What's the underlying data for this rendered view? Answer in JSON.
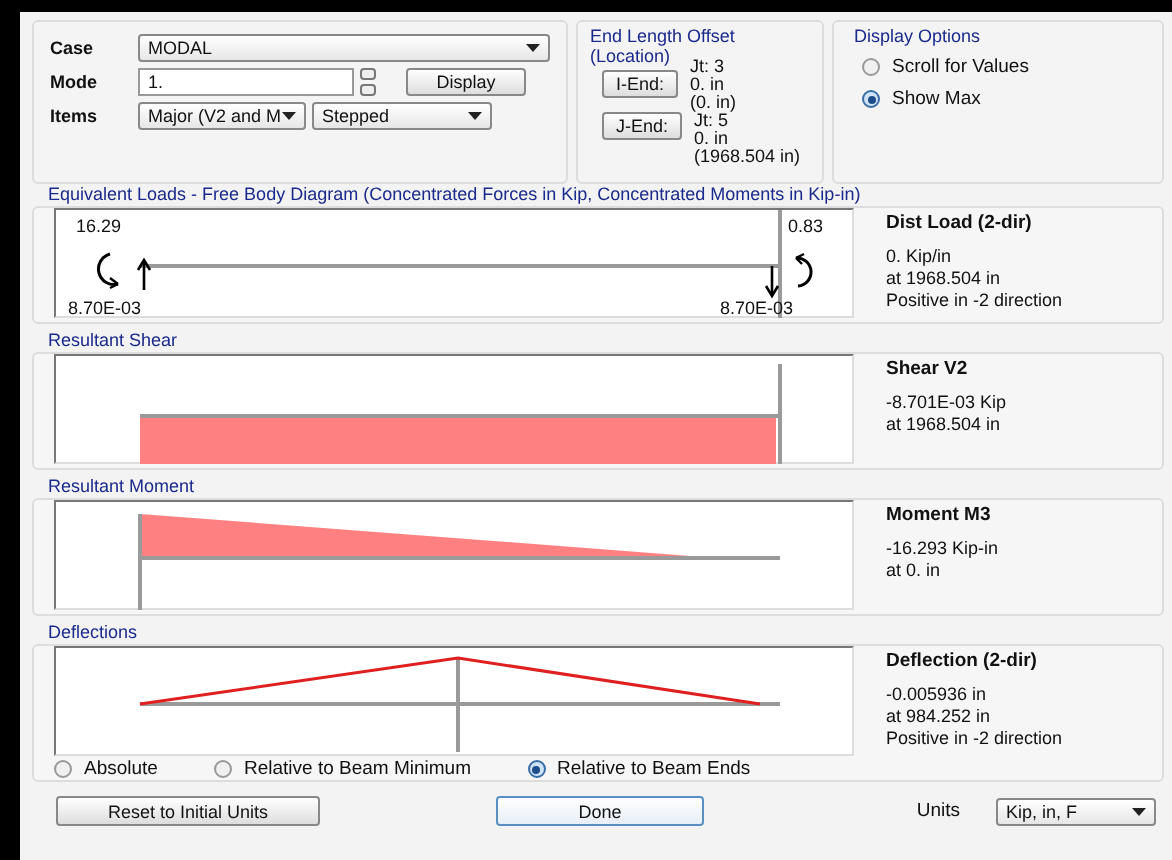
{
  "analysis": {
    "case": {
      "label": "Case",
      "value": "MODAL"
    },
    "mode": {
      "label": "Mode",
      "value": "1.",
      "button": "Display"
    },
    "items": {
      "label": "Items",
      "values": [
        "Major (V2 and M",
        "Stepped"
      ]
    }
  },
  "end_length_offset": {
    "title": "End Length Offset",
    "subtitle": "(Location)",
    "ends": [
      {
        "button": "I-End:",
        "joint": "Jt: 3",
        "offset": "0. in",
        "location": "(0. in)"
      },
      {
        "button": "J-End:",
        "joint": "Jt: 5",
        "offset": "0. in",
        "location": "(1968.504 in)"
      }
    ]
  },
  "display_options": {
    "title": "Display Options",
    "options": [
      {
        "label": "Scroll for Values",
        "selected": false
      },
      {
        "label": "Show Max",
        "selected": true
      }
    ]
  },
  "sections": [
    {
      "kind": "loads",
      "title": "Equivalent Loads - Free Body Diagram  (Concentrated Forces in Kip, Concentrated Moments in Kip-in)",
      "labels": [
        "16.29",
        "0.83",
        "8.70E-03",
        "8.70E-03"
      ],
      "readout_title": "Dist Load (2-dir)",
      "readout_lines": [
        "0. Kip/in",
        "at 1968.504 in",
        "Positive in -2 direction"
      ]
    },
    {
      "kind": "shear",
      "title": "Resultant Shear",
      "readout_title": "Shear V2",
      "readout_lines": [
        "-8.701E-03 Kip",
        "at 1968.504 in"
      ]
    },
    {
      "kind": "moment",
      "title": "Resultant Moment",
      "readout_title": "Moment M3",
      "readout_lines": [
        "-16.293 Kip-in",
        "at 0. in"
      ]
    },
    {
      "kind": "deflection",
      "title": "Deflections",
      "readout_title": "Deflection (2-dir)",
      "readout_lines": [
        "-0.005936 in",
        "at 984.252 in",
        "Positive in -2 direction"
      ],
      "options": [
        {
          "label": "Absolute",
          "selected": false
        },
        {
          "label": "Relative to Beam Minimum",
          "selected": false
        },
        {
          "label": "Relative to Beam Ends",
          "selected": true
        }
      ]
    }
  ],
  "footer": {
    "reset_button": "Reset to Initial Units",
    "done_button": "Done",
    "units_label": "Units",
    "units_value": "Kip, in, F"
  }
}
